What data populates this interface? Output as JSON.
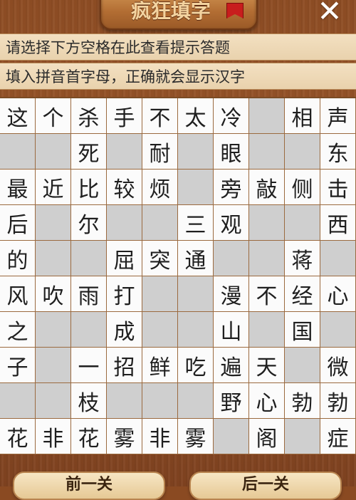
{
  "header": {
    "title": "疯狂填字",
    "close_label": "✕"
  },
  "hints": {
    "line1": "请选择下方空格在此查看提示答题",
    "line2": "填入拼音首字母，正确就会显示汉字"
  },
  "grid": {
    "rows": [
      [
        "这",
        "个",
        "杀",
        "手",
        "不",
        "太",
        "冷",
        "",
        "相",
        "声"
      ],
      [
        "",
        "",
        "死",
        "",
        "耐",
        "",
        "眼",
        "",
        "",
        "东"
      ],
      [
        "最",
        "近",
        "比",
        "较",
        "烦",
        "",
        "旁",
        "敲",
        "侧",
        "击"
      ],
      [
        "后",
        "",
        "尔",
        "",
        "",
        "三",
        "观",
        "",
        "",
        "西"
      ],
      [
        "的",
        "",
        "",
        "屈",
        "突",
        "通",
        "",
        "",
        "蒋",
        ""
      ],
      [
        "风",
        "吹",
        "雨",
        "打",
        "",
        "",
        "漫",
        "不",
        "经",
        "心"
      ],
      [
        "之",
        "",
        "",
        "成",
        "",
        "",
        "山",
        "",
        "国",
        ""
      ],
      [
        "子",
        "",
        "一",
        "招",
        "鲜",
        "吃",
        "遍",
        "天",
        "",
        "微"
      ],
      [
        "",
        "",
        "枝",
        "",
        "",
        "",
        "野",
        "心",
        "勃",
        "勃"
      ],
      [
        "花",
        "非",
        "花",
        "雾",
        "非",
        "雾",
        "",
        "阁",
        "",
        "症"
      ]
    ]
  },
  "footer": {
    "prev_label": "前一关",
    "next_label": "后一关"
  }
}
